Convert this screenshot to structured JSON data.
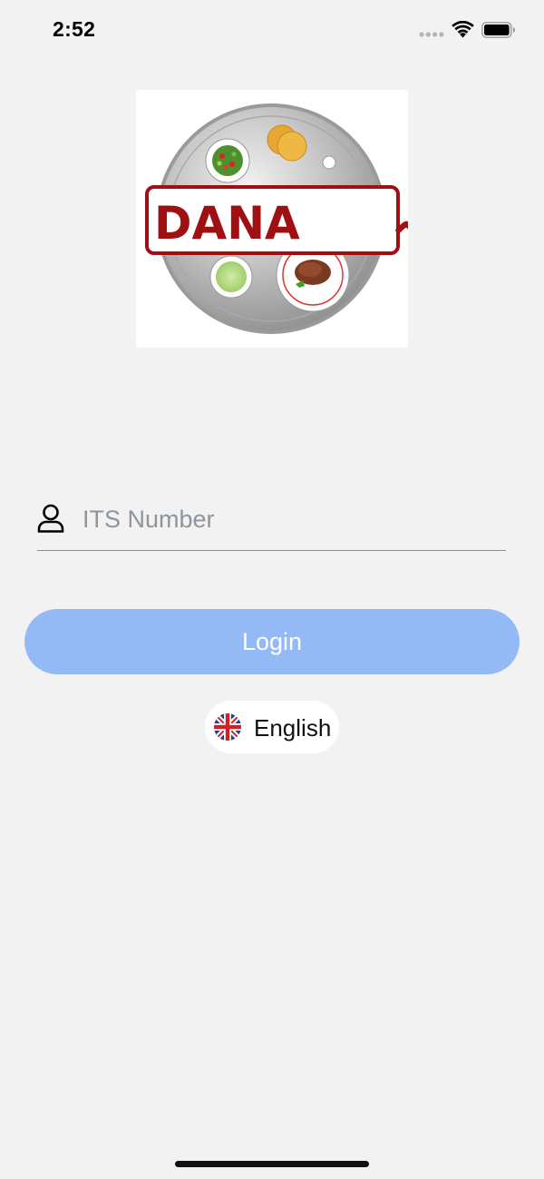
{
  "status_bar": {
    "time": "2:52"
  },
  "logo": {
    "latin_text": "DANA",
    "arabic_text": "دانہ",
    "colors": {
      "banner_border": "#a00f12",
      "banner_text": "#a00f12",
      "plate": "#b8b8b8"
    }
  },
  "login_form": {
    "its_field": {
      "placeholder": "ITS Number",
      "value": "",
      "icon": "user-icon"
    },
    "login_button": {
      "label": "Login",
      "color": "#94baf5"
    }
  },
  "language": {
    "label": "English",
    "flag_icon": "uk-flag-icon"
  }
}
